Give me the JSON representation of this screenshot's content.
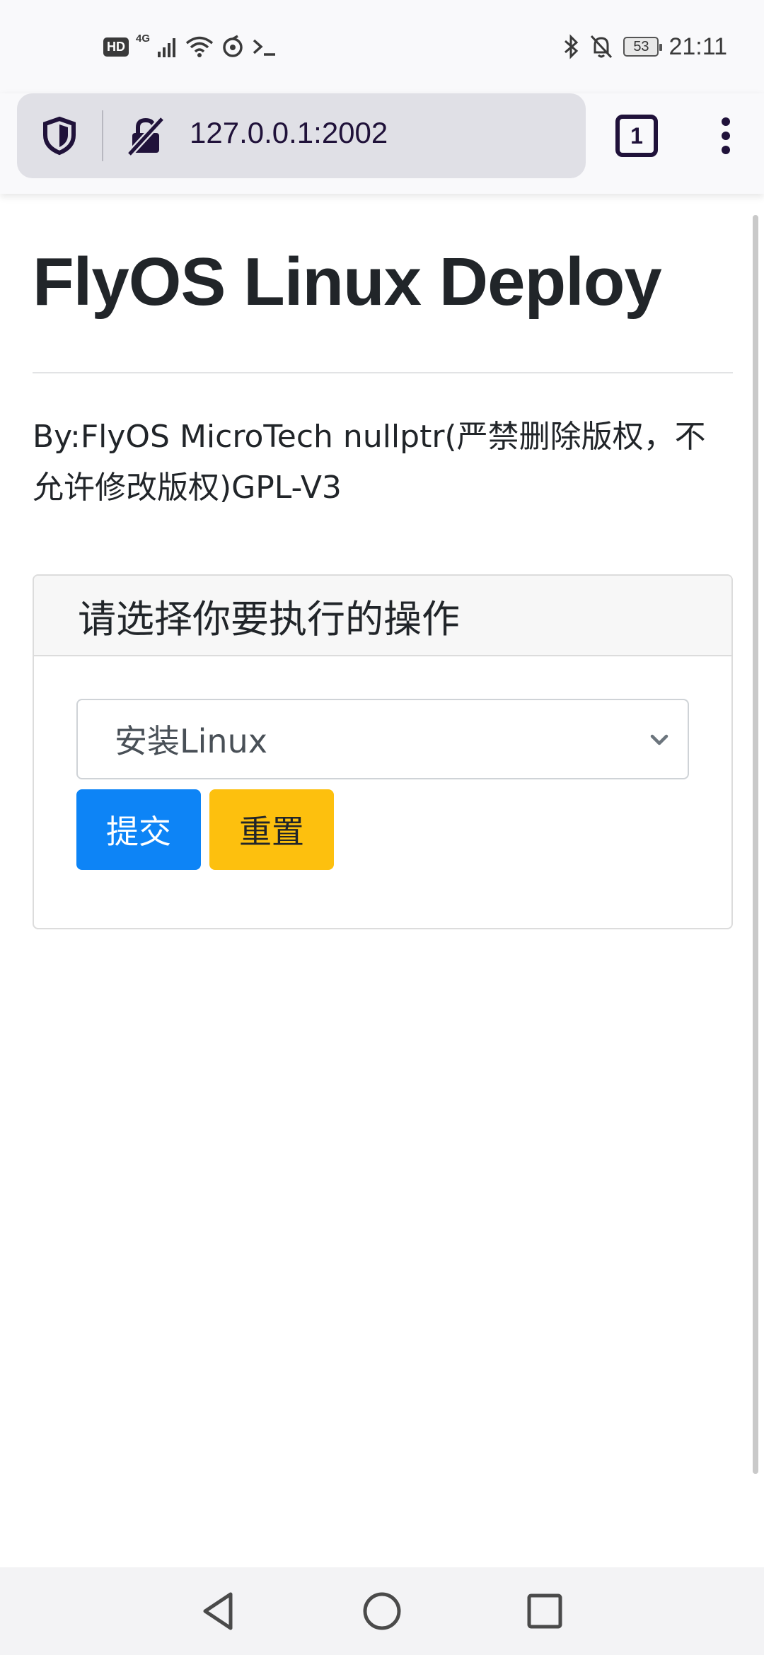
{
  "status_bar": {
    "left": {
      "hd_label": "HD",
      "network_label": "4G",
      "icons": [
        "hd-icon",
        "signal-icon",
        "wifi-icon",
        "sync-icon",
        "terminal-icon"
      ]
    },
    "right": {
      "icons": [
        "bluetooth-icon",
        "bell-off-icon",
        "battery-icon"
      ],
      "battery_level": "53",
      "time": "21:11"
    }
  },
  "browser": {
    "url": "127.0.0.1:2002",
    "tab_count": "1",
    "icons": [
      "shield-icon",
      "insecure-lock-icon",
      "tabs-icon",
      "kebab-menu-icon"
    ]
  },
  "page": {
    "title": "FlyOS Linux Deploy",
    "byline": "By:FlyOS MicroTech nullptr(严禁删除版权，不允许修改版权)GPL-V3",
    "card": {
      "header": "请选择你要执行的操作",
      "select": {
        "selected": "安装Linux"
      },
      "submit_label": "提交",
      "reset_label": "重置"
    }
  },
  "nav_bar": {
    "icons": [
      "back-icon",
      "home-icon",
      "recents-icon"
    ]
  },
  "colors": {
    "primary_button": "#0d84f6",
    "warning_button": "#fdc00e",
    "toolbar_text": "#20123a",
    "urlbar_bg": "#e0e0e6"
  }
}
